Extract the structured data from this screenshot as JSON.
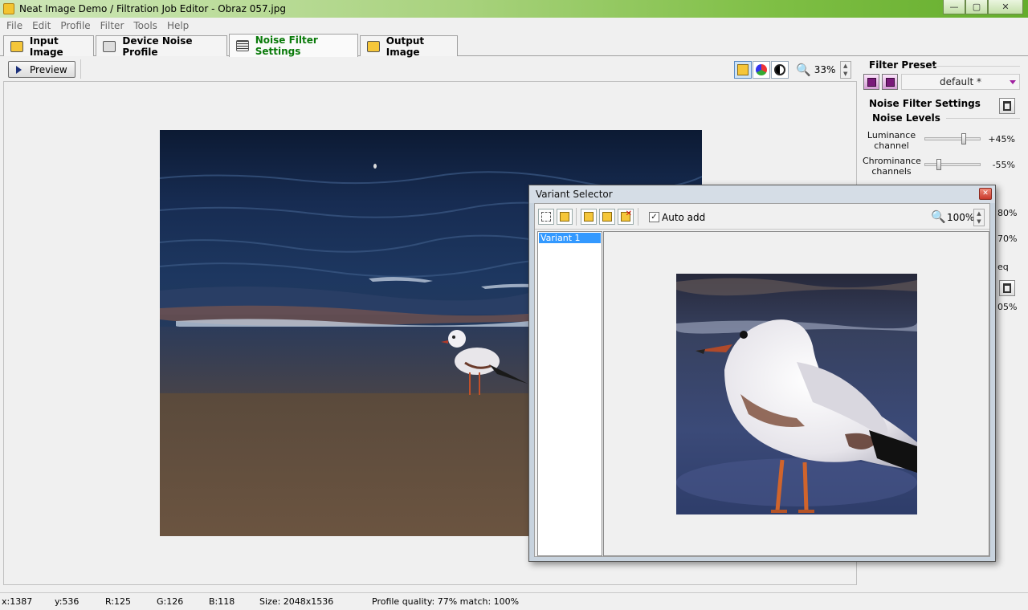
{
  "window": {
    "title": "Neat Image Demo / Filtration Job Editor - Obraz 057.jpg",
    "controls": [
      "minimize",
      "maximize",
      "close"
    ]
  },
  "menu": [
    "File",
    "Edit",
    "Profile",
    "Filter",
    "Tools",
    "Help"
  ],
  "tabs": [
    {
      "label": "Input Image",
      "icon": "input-image-icon"
    },
    {
      "label": "Device Noise Profile",
      "icon": "device-noise-profile-icon"
    },
    {
      "label": "Noise Filter Settings",
      "icon": "noise-filter-settings-icon",
      "active": true
    },
    {
      "label": "Output Image",
      "icon": "output-image-icon"
    }
  ],
  "toolbar": {
    "preview_label": "Preview",
    "zoom": "33%"
  },
  "right_panel": {
    "filter_preset_title": "Filter Preset",
    "preset_value": "default *",
    "noise_filter_settings_title": "Noise Filter Settings",
    "noise_levels_title": "Noise Levels",
    "luminance_label_1": "Luminance",
    "luminance_label_2": "channel",
    "luminance_value": "+45%",
    "luminance_level": 0.72,
    "chrominance_label_1": "Chrominance",
    "chrominance_label_2": "channels",
    "chrominance_value": "-55%",
    "chrominance_level": 0.22,
    "partial_value_1": "80%",
    "partial_value_2": "70%",
    "partial_text_1": "eq",
    "partial_value_3": "05%"
  },
  "variant_selector": {
    "title": "Variant Selector",
    "auto_add_label": "Auto add",
    "auto_add_checked": true,
    "zoom": "100%",
    "variants": [
      "Variant 1"
    ]
  },
  "status": {
    "x": "x:1387",
    "y": "y:536",
    "r": "R:125",
    "g": "G:126",
    "b": "B:118",
    "size": "Size: 2048x1536",
    "profile": "Profile quality: 77%  match: 100%"
  },
  "colors": {
    "title_gradient_end": "#64ad2c",
    "active_tab_text": "#0a7a0a",
    "selection": "#3399ff"
  }
}
